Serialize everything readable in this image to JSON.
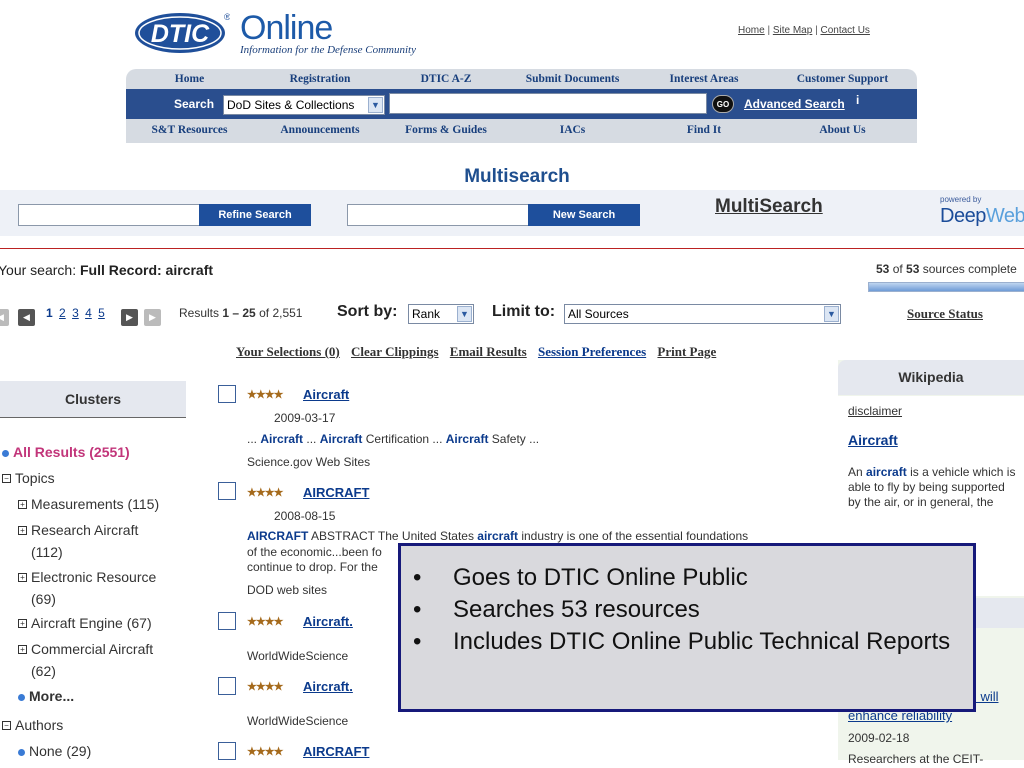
{
  "header": {
    "logo_text": "DTIC",
    "brand": "Online",
    "tagline": "Information for the Defense Community",
    "toplinks": [
      "Home",
      "Site Map",
      "Contact Us"
    ]
  },
  "nav_top": [
    "Home",
    "Registration",
    "DTIC A-Z",
    "Submit Documents",
    "Interest Areas",
    "Customer Support"
  ],
  "search_bar": {
    "label": "Search",
    "scope": "DoD Sites & Collections",
    "go": "GO",
    "advanced": "Advanced Search",
    "info": "i"
  },
  "nav_bottom": [
    "S&T Resources",
    "Announcements",
    "Forms & Guides",
    "IACs",
    "Find It",
    "About Us"
  ],
  "multisearch": {
    "title": "Multisearch",
    "refine_button": "Refine Search",
    "new_button": "New Search",
    "logo": "MultiSearch",
    "powered_by": "powered by",
    "deep": "Deep",
    "web": "Web"
  },
  "status": {
    "your_search_prefix": "Your search:",
    "your_search_value": "Full Record: aircraft",
    "sources_done": "53",
    "sources_total": "53",
    "sources_suffix": "sources complete",
    "progress_fraction": 1.0,
    "source_status": "Source Status"
  },
  "paging": {
    "pages": [
      "1",
      "2",
      "3",
      "4",
      "5"
    ],
    "results_label": "Results",
    "range": "1 – 25",
    "of_label": "of",
    "total": "2,551",
    "sort_label": "Sort by:",
    "sort_value": "Rank",
    "limit_label": "Limit to:",
    "limit_value": "All Sources"
  },
  "actions": [
    "Your Selections (0)",
    "Clear Clippings",
    "Email Results",
    "Session Preferences",
    "Print Page"
  ],
  "clusters": {
    "title": "Clusters",
    "all_results": "All Results (2551)",
    "topics_label": "Topics",
    "topics": [
      {
        "line1": "Measurements (115)",
        "line2": ""
      },
      {
        "line1": "Research Aircraft",
        "line2": "(112)"
      },
      {
        "line1": "Electronic Resource",
        "line2": "(69)"
      },
      {
        "line1": "Aircraft Engine (67)",
        "line2": ""
      },
      {
        "line1": "Commercial Aircraft",
        "line2": "(62)"
      }
    ],
    "more": "More...",
    "authors_label": "Authors",
    "authors": [
      "None (29)"
    ]
  },
  "results": [
    {
      "stars": "★★★★",
      "title": "Aircraft",
      "date": "2009-03-17",
      "snippet": "... Aircraft ... Aircraft Certification ... Aircraft Safety ...",
      "source": "Science.gov Web Sites"
    },
    {
      "stars": "★★★★",
      "title": "AIRCRAFT",
      "date": "2008-08-15",
      "snippet": "AIRCRAFT ABSTRACT The United States aircraft industry is one of the essential foundations",
      "snippet2": "of the economic...been fo",
      "snippet3": "continue to drop. For the",
      "source": "DOD web sites"
    },
    {
      "stars": "★★★★",
      "title": "Aircraft.",
      "date": "",
      "snippet": "",
      "source": "WorldWideScience"
    },
    {
      "stars": "★★★★",
      "title": "Aircraft.",
      "date": "",
      "snippet": "",
      "source": "WorldWideScience"
    },
    {
      "stars": "★★★★",
      "title": "AIRCRAFT",
      "date": "",
      "snippet": "",
      "source": ""
    }
  ],
  "wikipedia": {
    "title": "Wikipedia",
    "disclaimer": "disclaimer",
    "article_title": "Aircraft",
    "text_pre": "An",
    "text_bold": "aircraft",
    "text_post": "is a vehicle which is able to fly by being supported by the air, or in general, the",
    "lower_link_tail": "m will",
    "lower_link": "enhance reliability",
    "lower_date": "2009-02-18",
    "lower_text": "Researchers at the CEIT-"
  },
  "callout": {
    "items": [
      "Goes to DTIC Online Public",
      "Searches 53 resources",
      "Includes DTIC Online Public Technical Reports"
    ]
  }
}
